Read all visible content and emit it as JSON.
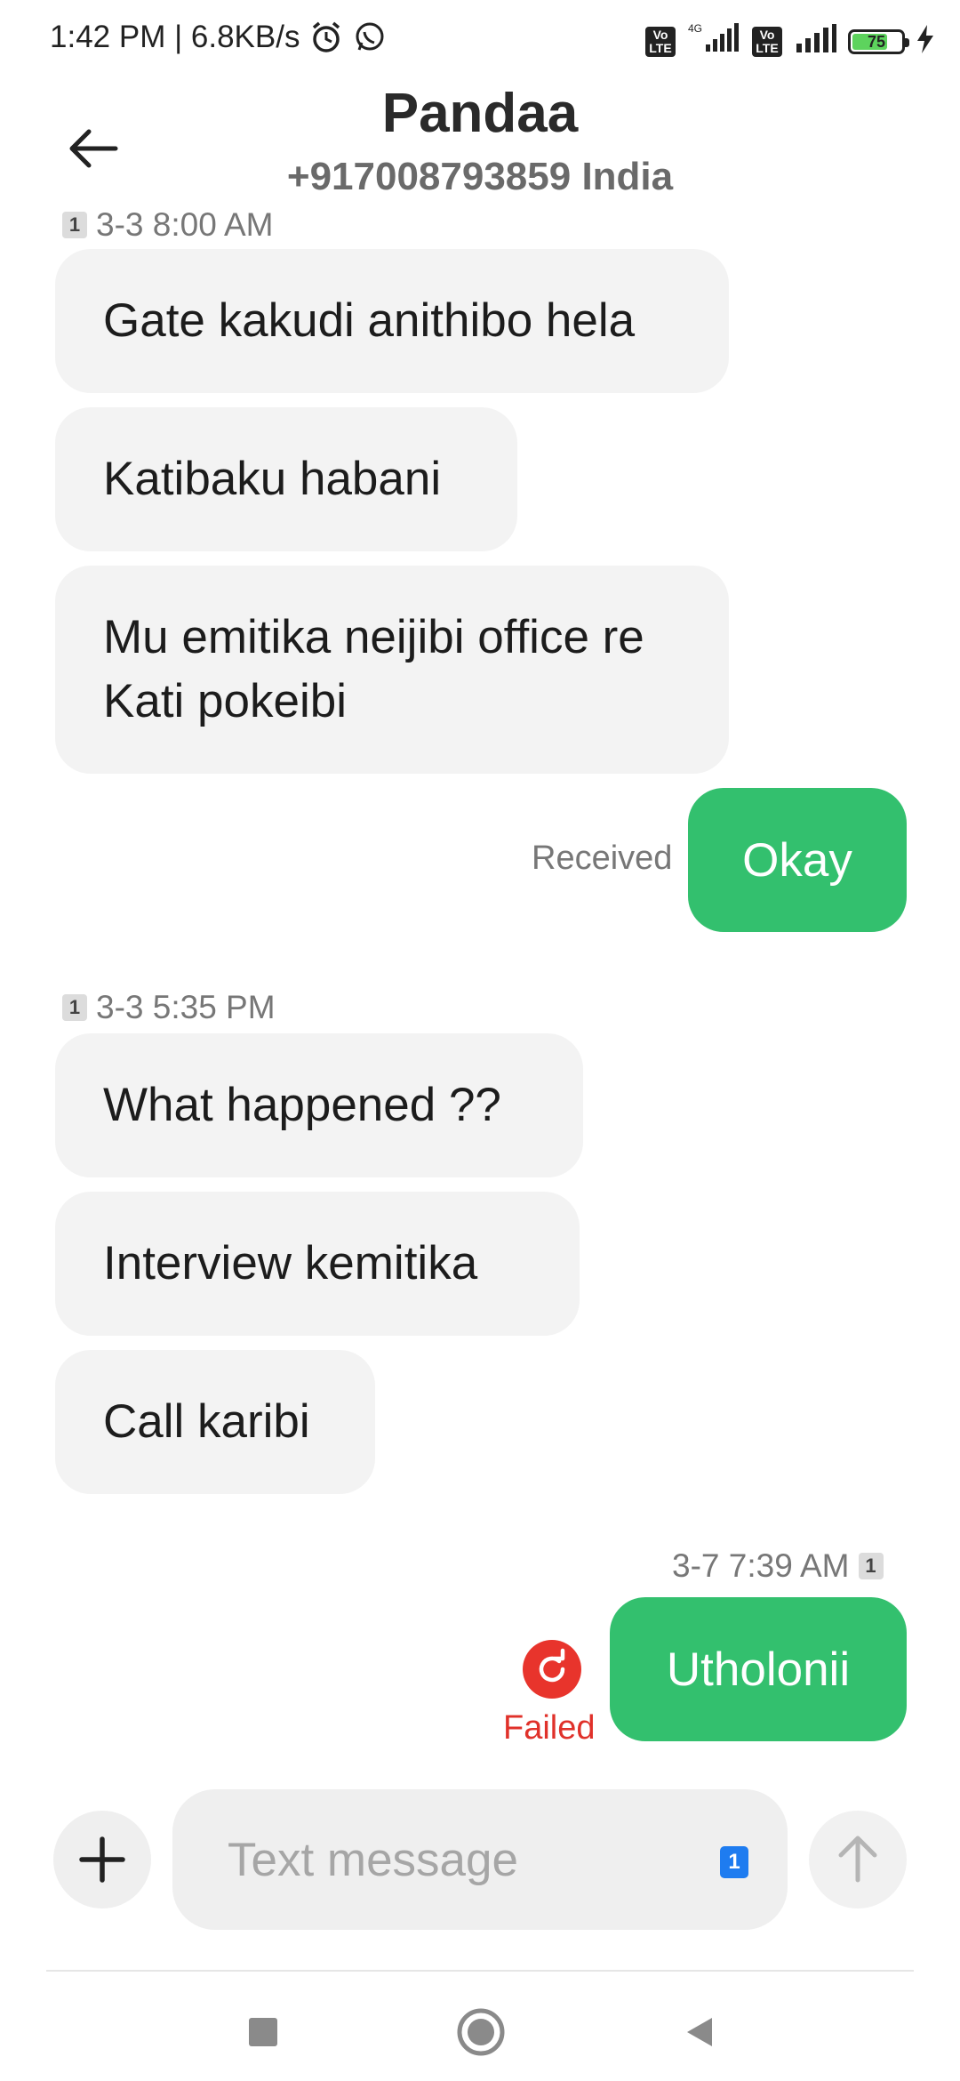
{
  "status_bar": {
    "time_speed": "1:42 PM | 6.8KB/s",
    "battery_level": "75",
    "battery_fraction": 0.75,
    "network": "4G",
    "volte_label": "Vo\nLTE",
    "icons": [
      "alarm-icon",
      "whatsapp-icon",
      "volte-icon",
      "signal-icon",
      "battery-icon",
      "charging-icon"
    ]
  },
  "header": {
    "contact_name": "Pandaa",
    "contact_sub": "+917008793859 India"
  },
  "thread": {
    "groups": [
      {
        "timestamp": "3-3 8:00 AM",
        "sim": "1",
        "incoming": [
          "Gate kakudi anithibo hela",
          "Katibaku habani",
          "Mu emitika neijibi office re Kati pokeibi"
        ],
        "outgoing": {
          "text": "Okay",
          "status": "Received"
        }
      },
      {
        "timestamp": "3-3 5:35 PM",
        "sim": "1",
        "incoming": [
          "What happened  ??",
          "Interview kemitika",
          "Call karibi"
        ]
      },
      {
        "timestamp": "3-7 7:39 AM",
        "sim": "1",
        "outgoing": {
          "text": "Utholonii",
          "status": "Failed"
        }
      }
    ]
  },
  "composer": {
    "placeholder": "Text message",
    "sim_badge": "1"
  },
  "colors": {
    "outgoing_bubble": "#33c06e",
    "incoming_bubble": "#f3f3f3",
    "failed": "#e0312a"
  }
}
